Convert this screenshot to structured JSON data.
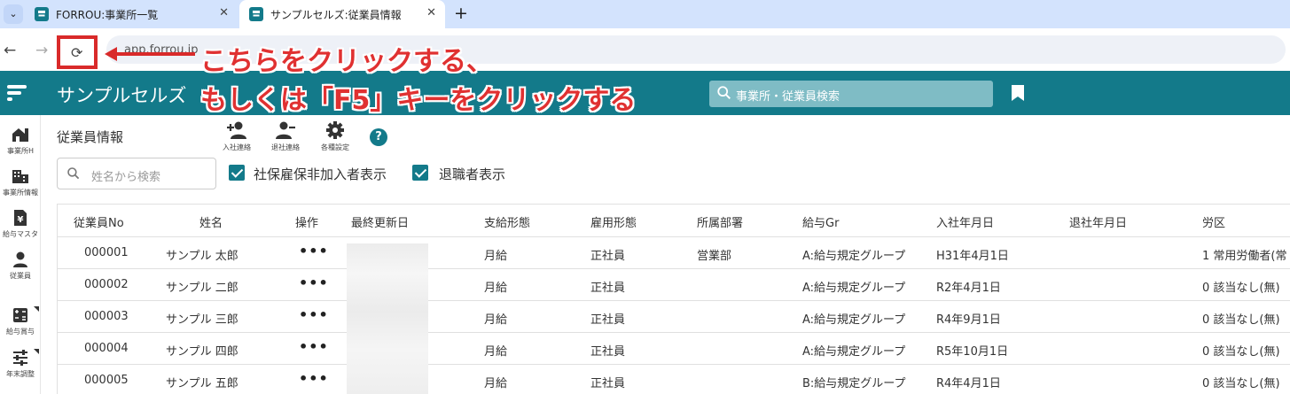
{
  "browser": {
    "tabs": [
      {
        "title": "FORROU:事業所一覧",
        "close": "✕"
      },
      {
        "title": "サンプルセルズ:従業員情報",
        "close": "✕"
      }
    ],
    "tab_menu": "⌄",
    "new_tab": "+",
    "back": "←",
    "forward": "→",
    "reload": "⟳",
    "url": "app.forrou.jp"
  },
  "header": {
    "company": "サンプルセルズ",
    "search_placeholder": "事業所・従業員検索"
  },
  "sidebar": {
    "items": [
      {
        "label": "事業所H"
      },
      {
        "label": "事業所情報"
      },
      {
        "label": "給与マスタ"
      },
      {
        "label": "従業員"
      },
      {
        "label": "給与賞与"
      },
      {
        "label": "年末調整"
      }
    ]
  },
  "page": {
    "title": "従業員情報",
    "tools": [
      {
        "label": "入社連絡"
      },
      {
        "label": "退社連絡"
      },
      {
        "label": "各種設定"
      }
    ],
    "help": "?",
    "name_search_placeholder": "姓名から検索",
    "checkbox_insurance": "社保雇保非加入者表示",
    "checkbox_retired": "退職者表示"
  },
  "table": {
    "columns": [
      "従業員No",
      "姓名",
      "操作",
      "最終更新日",
      "支給形態",
      "雇用形態",
      "所属部署",
      "給与Gr",
      "入社年月日",
      "退社年月日",
      "労区"
    ],
    "action_glyph": "•••",
    "rows": [
      {
        "no": "000001",
        "name": "サンプル 太郎",
        "pay": "月給",
        "emp": "正社員",
        "dept": "営業部",
        "grp": "A:給与規定グループ",
        "join": "H31年4月1日",
        "leave": "",
        "labor": "1 常用労働者(常"
      },
      {
        "no": "000002",
        "name": "サンプル 二郎",
        "pay": "月給",
        "emp": "正社員",
        "dept": "",
        "grp": "A:給与規定グループ",
        "join": "R2年4月1日",
        "leave": "",
        "labor": "0 該当なし(無)"
      },
      {
        "no": "000003",
        "name": "サンプル 三郎",
        "pay": "月給",
        "emp": "正社員",
        "dept": "",
        "grp": "A:給与規定グループ",
        "join": "R4年9月1日",
        "leave": "",
        "labor": "0 該当なし(無)"
      },
      {
        "no": "000004",
        "name": "サンプル 四郎",
        "pay": "月給",
        "emp": "正社員",
        "dept": "",
        "grp": "A:給与規定グループ",
        "join": "R5年10月1日",
        "leave": "",
        "labor": "0 該当なし(無)"
      },
      {
        "no": "000005",
        "name": "サンプル 五郎",
        "pay": "月給",
        "emp": "正社員",
        "dept": "",
        "grp": "B:給与規定グループ",
        "join": "R4年4月1日",
        "leave": "",
        "labor": "0 該当なし(無)"
      }
    ]
  },
  "annotation": {
    "line1": "こちらをクリックする、",
    "line2": "もしくは「F5」キーをクリックする"
  },
  "colors": {
    "brand": "#137a8a",
    "annotation": "#e03131",
    "tabstrip": "#d3e3fd"
  },
  "icons": [
    "reload-icon",
    "search-icon",
    "bookmark-icon",
    "home-icon",
    "building-icon",
    "yen-icon",
    "person-icon",
    "calculator-icon",
    "tune-icon",
    "person-add-icon",
    "person-remove-icon",
    "gear-icon",
    "help-icon"
  ]
}
